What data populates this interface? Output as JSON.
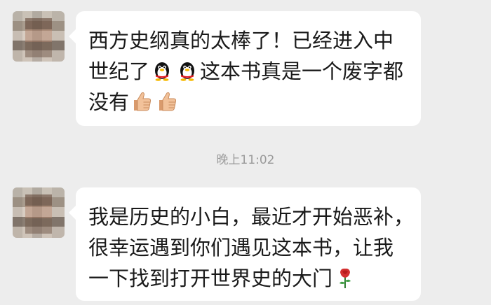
{
  "messages": [
    {
      "lines": [
        "西方史纲真的太棒了！已经进入中",
        "世纪了",
        "这本书真是一个废字都",
        "没有"
      ],
      "emoji": [
        "qq-penguin-icon",
        "qq-penguin-icon",
        "thumbs-up-icon",
        "thumbs-up-icon"
      ]
    },
    {
      "lines": [
        "我是历史的小白，最近才开始恶补，",
        "很幸运遇到你们遇见这本书，让我",
        "一下找到打开世界史的大门"
      ],
      "emoji": [
        "rose-icon"
      ]
    }
  ],
  "timestamp": "晚上11:02",
  "colors": {
    "background": "#ededed",
    "bubble": "#ffffff",
    "text": "#1a1a1a",
    "timestamp": "#9a9a9a"
  }
}
